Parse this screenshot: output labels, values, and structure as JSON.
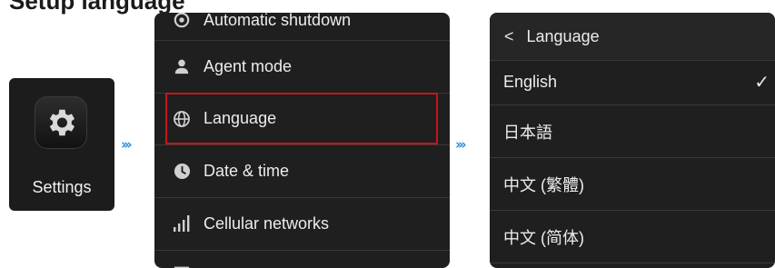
{
  "heading": {
    "text": "Setup language"
  },
  "app": {
    "label": "Settings",
    "icon": "gear-icon"
  },
  "arrows": {
    "glyph": "›››"
  },
  "settings_menu": {
    "items": [
      {
        "label": "Automatic shutdown",
        "icon": "power-icon"
      },
      {
        "label": "Agent mode",
        "icon": "person-icon"
      },
      {
        "label": "Language",
        "icon": "globe-icon",
        "highlighted": true
      },
      {
        "label": "Date & time",
        "icon": "clock-icon"
      },
      {
        "label": "Cellular networks",
        "icon": "signal-bars-icon"
      }
    ]
  },
  "language_screen": {
    "back_glyph": "<",
    "title": "Language",
    "options": [
      {
        "label": "English",
        "selected": true
      },
      {
        "label": "日本語",
        "selected": false
      },
      {
        "label": "中文 (繁體)",
        "selected": false
      },
      {
        "label": "中文 (简体)",
        "selected": false
      }
    ],
    "check_glyph": "✓"
  },
  "colors": {
    "highlight": "#c4161c",
    "arrow": "#2b8fd6",
    "panel": "#1f1f1f"
  }
}
